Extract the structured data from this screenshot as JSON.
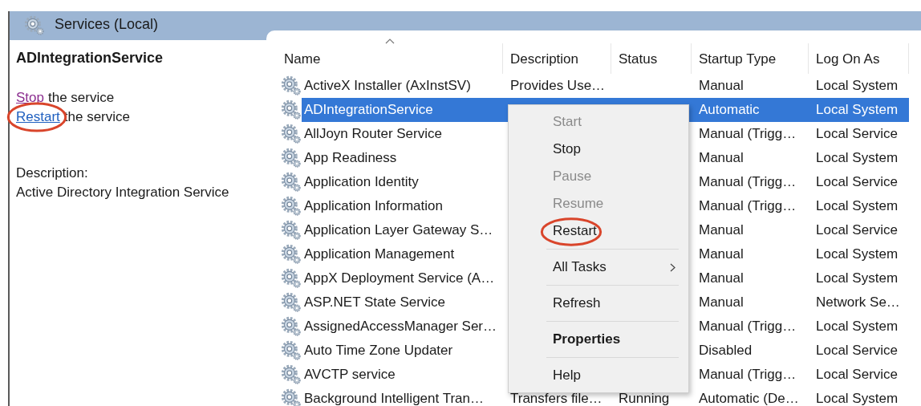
{
  "header": {
    "title": "Services (Local)"
  },
  "details": {
    "title": "ADIntegrationService",
    "actions": [
      {
        "link": "Stop",
        "rest": "the service",
        "visited": true,
        "highlighted": false
      },
      {
        "link": "Restart",
        "rest": "the service",
        "visited": false,
        "highlighted": true
      }
    ],
    "description_label": "Description:",
    "description": "Active Directory Integration Service"
  },
  "table": {
    "columns": [
      "Name",
      "Description",
      "Status",
      "Startup Type",
      "Log On As"
    ],
    "rows": [
      {
        "name": "ActiveX Installer (AxInstSV)",
        "description": "Provides Use…",
        "startup_type": "Manual",
        "log_on_as": "Local System",
        "selected": false
      },
      {
        "name": "ADIntegrationService",
        "startup_type": "Automatic",
        "log_on_as": "Local System",
        "selected": true
      },
      {
        "name": "AllJoyn Router Service",
        "startup_type": "Manual (Trigg…",
        "log_on_as": "Local Service",
        "selected": false
      },
      {
        "name": "App Readiness",
        "startup_type": "Manual",
        "log_on_as": "Local System",
        "selected": false
      },
      {
        "name": "Application Identity",
        "startup_type": "Manual (Trigg…",
        "log_on_as": "Local Service",
        "selected": false
      },
      {
        "name": "Application Information",
        "startup_type": "Manual (Trigg…",
        "log_on_as": "Local System",
        "selected": false
      },
      {
        "name": "Application Layer Gateway S…",
        "startup_type": "Manual",
        "log_on_as": "Local Service",
        "selected": false
      },
      {
        "name": "Application Management",
        "startup_type": "Manual",
        "log_on_as": "Local System",
        "selected": false
      },
      {
        "name": "AppX Deployment Service (A…",
        "startup_type": "Manual",
        "log_on_as": "Local System",
        "selected": false
      },
      {
        "name": "ASP.NET State Service",
        "startup_type": "Manual",
        "log_on_as": "Network Se…",
        "selected": false
      },
      {
        "name": "AssignedAccessManager Ser…",
        "startup_type": "Manual (Trigg…",
        "log_on_as": "Local System",
        "selected": false
      },
      {
        "name": "Auto Time Zone Updater",
        "startup_type": "Disabled",
        "log_on_as": "Local Service",
        "selected": false
      },
      {
        "name": "AVCTP service",
        "startup_type": "Manual (Trigg…",
        "log_on_as": "Local Service",
        "selected": false
      },
      {
        "name": "Background Intelligent Tran…",
        "description": "Transfers file…",
        "status": "Running",
        "startup_type": "Automatic (De…",
        "log_on_as": "Local System",
        "selected": false
      }
    ]
  },
  "context_menu": {
    "items": [
      {
        "kind": "item",
        "label": "Start",
        "disabled": true,
        "bold": false,
        "highlighted": false,
        "submenu": false
      },
      {
        "kind": "item",
        "label": "Stop",
        "disabled": false,
        "bold": false,
        "highlighted": false,
        "submenu": false
      },
      {
        "kind": "item",
        "label": "Pause",
        "disabled": true,
        "bold": false,
        "highlighted": false,
        "submenu": false
      },
      {
        "kind": "item",
        "label": "Resume",
        "disabled": true,
        "bold": false,
        "highlighted": false,
        "submenu": false
      },
      {
        "kind": "item",
        "label": "Restart",
        "disabled": false,
        "bold": false,
        "highlighted": true,
        "submenu": false
      },
      {
        "kind": "separator"
      },
      {
        "kind": "item",
        "label": "All Tasks",
        "disabled": false,
        "bold": false,
        "highlighted": false,
        "submenu": true
      },
      {
        "kind": "separator"
      },
      {
        "kind": "item",
        "label": "Refresh",
        "disabled": false,
        "bold": false,
        "highlighted": false,
        "submenu": false
      },
      {
        "kind": "separator"
      },
      {
        "kind": "item",
        "label": "Properties",
        "disabled": false,
        "bold": true,
        "highlighted": false,
        "submenu": false
      },
      {
        "kind": "separator"
      },
      {
        "kind": "item",
        "label": "Help",
        "disabled": false,
        "bold": false,
        "highlighted": false,
        "submenu": false
      }
    ]
  }
}
